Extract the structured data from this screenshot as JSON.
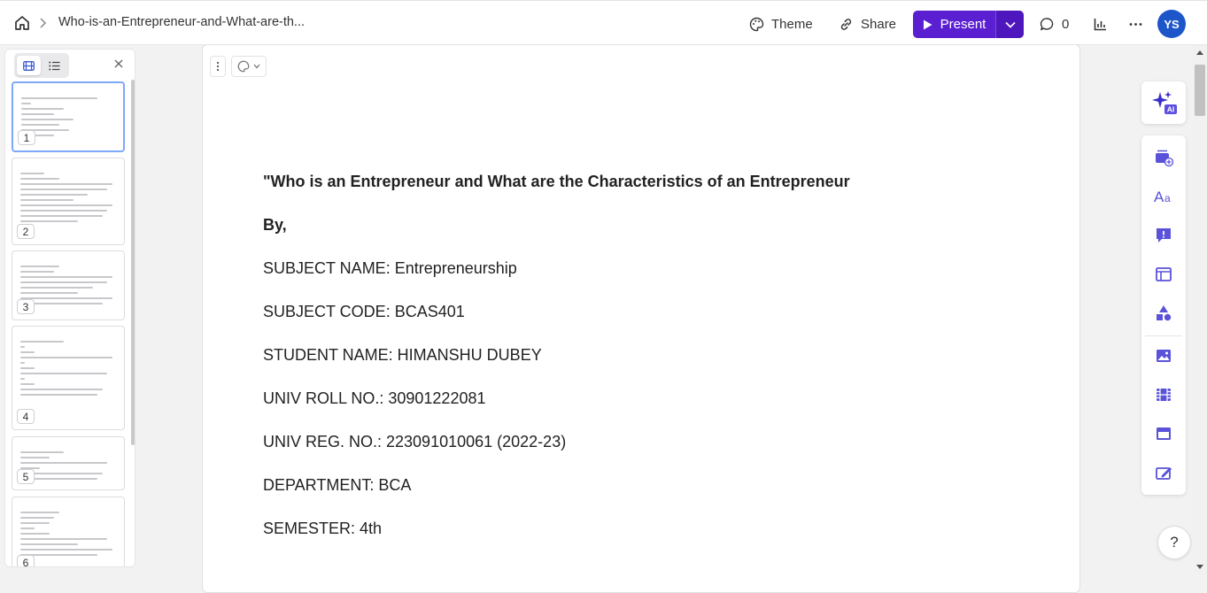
{
  "topbar": {
    "doc_title": "Who-is-an-Entrepreneur-and-What-are-th...",
    "theme_label": "Theme",
    "share_label": "Share",
    "present_label": "Present",
    "comment_count": "0",
    "avatar_initials": "YS",
    "accent_color": "#5a1fd1"
  },
  "slides_panel": {
    "thumbnails": [
      {
        "number": "1"
      },
      {
        "number": "2"
      },
      {
        "number": "3"
      },
      {
        "number": "4"
      },
      {
        "number": "5"
      },
      {
        "number": "6"
      }
    ]
  },
  "card": {
    "lines": [
      "\"Who is an Entrepreneur and What are the Characteristics of an Entrepreneur",
      "By,",
      "SUBJECT NAME: Entrepreneurship",
      "SUBJECT CODE: BCAS401",
      "STUDENT NAME: HIMANSHU DUBEY",
      "UNIV ROLL NO.: 30901222081",
      "UNIV REG. NO.: 223091010061 (2022-23)",
      "DEPARTMENT: BCA",
      "SEMESTER: 4th"
    ]
  },
  "right_rail": {
    "ai_badge": "AI",
    "help_label": "?"
  }
}
